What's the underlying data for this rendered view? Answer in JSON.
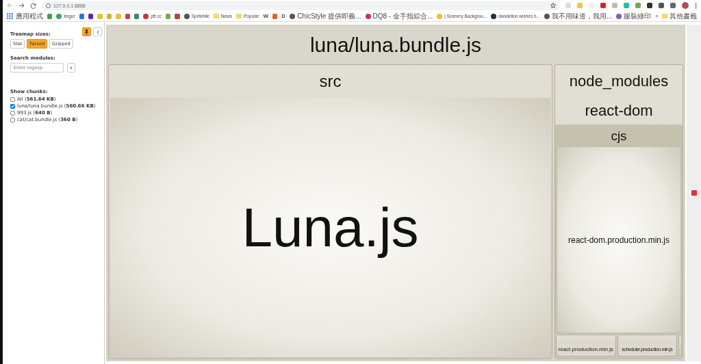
{
  "browser": {
    "url": "127.0.0.1:8888",
    "bookmarks": [
      {
        "kind": "apps",
        "label": "應用程式"
      },
      {
        "kind": "icon",
        "color": "#4a9a4a"
      },
      {
        "kind": "link",
        "label": "imgur",
        "color": "#3aa66a"
      },
      {
        "kind": "icon",
        "color": "#1877f2"
      },
      {
        "kind": "icon",
        "color": "#6a1fb0"
      },
      {
        "kind": "icon",
        "color": "#e8c040"
      },
      {
        "kind": "icon",
        "color": "#e0b030"
      },
      {
        "kind": "icon",
        "color": "#f0c030"
      },
      {
        "kind": "icon",
        "color": "#d04040"
      },
      {
        "kind": "icon",
        "color": "#3a8a6a"
      },
      {
        "kind": "link",
        "label": "ptt.cc",
        "color": "#d03030"
      },
      {
        "kind": "icon",
        "color": "#6ab04a"
      },
      {
        "kind": "icon",
        "color": "#c04040"
      },
      {
        "kind": "link",
        "label": "SpriteMe",
        "color": "#555555"
      },
      {
        "kind": "folder",
        "label": "News"
      },
      {
        "kind": "folder",
        "label": "Popular"
      },
      {
        "kind": "text",
        "label": "W"
      },
      {
        "kind": "icon",
        "color": "#e06020"
      },
      {
        "kind": "text",
        "label": "D"
      },
      {
        "kind": "link",
        "label": "ChicStyle 提供即義...",
        "color": "#555555"
      },
      {
        "kind": "link",
        "label": "DQ8 - 金手指綜合...",
        "color": "#d03060"
      },
      {
        "kind": "link",
        "label": "| Scenery Backgrou...",
        "color": "#f0c020"
      },
      {
        "kind": "link",
        "label": "dandelion wishes b...",
        "color": "#203040"
      },
      {
        "kind": "link",
        "label": "我不用味道，我用...",
        "color": "#555555"
      },
      {
        "kind": "link",
        "label": "服裝綠印",
        "color": "#8a5ac0"
      },
      {
        "kind": "more",
        "label": "»"
      },
      {
        "kind": "folder",
        "label": "其他書籤"
      }
    ]
  },
  "sidebar": {
    "treemap_sizes": {
      "title": "Treemap sizes:",
      "options": [
        {
          "label": "Stat",
          "selected": false
        },
        {
          "label": "Parsed",
          "selected": true
        },
        {
          "label": "Gzipped",
          "selected": false
        }
      ]
    },
    "search": {
      "title": "Search modules:",
      "placeholder": "Enter regexp",
      "clear": "x"
    },
    "chunks": {
      "title": "Show chunks:",
      "items": [
        {
          "label": "All (**561.64 KB**)",
          "checked": false
        },
        {
          "label": "luna/luna.bundle.js (**560.66 KB**)",
          "checked": true
        },
        {
          "label": "993.js (**640 B**)",
          "checked": false
        },
        {
          "label": "cat/cat.bundle.js (**360 B**)",
          "checked": false
        }
      ]
    }
  },
  "treemap": {
    "label": "luna/luna.bundle.js",
    "children": [
      {
        "label": "src",
        "children": [
          {
            "label": "Luna.js"
          }
        ]
      },
      {
        "label": "node_modules",
        "children": [
          {
            "label": "react-dom",
            "children": [
              {
                "label": "cjs",
                "children": [
                  {
                    "label": "react-dom.production.min.js"
                  }
                ]
              }
            ]
          }
        ]
      }
    ],
    "bottom_modules": [
      {
        "label": "react.production.min.js"
      },
      {
        "label": "scheduler.production.min.js"
      }
    ]
  }
}
